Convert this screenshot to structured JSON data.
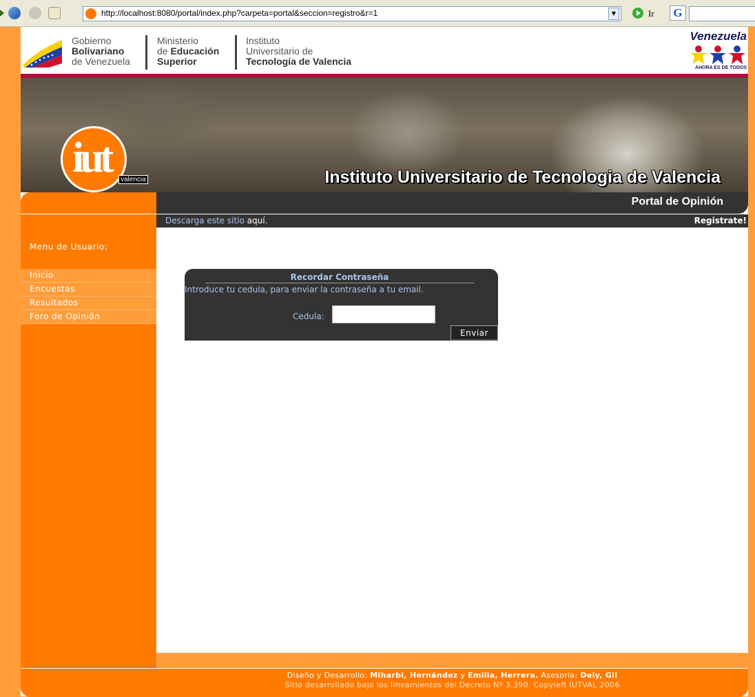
{
  "browser": {
    "url": "http://localhost:8080/portal/index.php?carpeta=portal&seccion=registro&r=1",
    "go_label": "Ir",
    "google_label": "G"
  },
  "gov_header": {
    "block1": {
      "line1": "Gobierno",
      "line2": "Bolivariano",
      "line3": "de Venezuela"
    },
    "block2": {
      "line1": "Ministerio",
      "line2_prefix": "de ",
      "line2_bold": "Educación",
      "line3": "Superior"
    },
    "block3": {
      "line1": "Instituto",
      "line2": "Universitario de",
      "line3": "Tecnología de Valencia"
    },
    "right_logo": {
      "word": "Venezuela",
      "tagline": "AHORA ES DE TODOS"
    }
  },
  "banner": {
    "logo_text": "iut",
    "logo_sub": "valencia",
    "title": "Instituto Universitario de Tecnologia de Valencia"
  },
  "portal": {
    "title": "Portal de Opinión"
  },
  "sub_strip": {
    "download_text": "Descarga este sitio",
    "download_link": "aquí.",
    "register_link": "Registrate!"
  },
  "sidebar": {
    "heading": "Menu de Usuario:",
    "items": [
      {
        "label": "Inicio"
      },
      {
        "label": "Encuestas"
      },
      {
        "label": "Resultados"
      },
      {
        "label": "Foro de Opinión"
      }
    ]
  },
  "form": {
    "title": "Recordar Contraseña",
    "instructions": "Introduce tu cedula, para enviar la contraseña a tu email.",
    "cedula_label": "Cedula:",
    "cedula_value": "",
    "submit_label": "Enviar"
  },
  "footer": {
    "line1_prefix": "Diseño y Desarrollo: ",
    "author1": "Miharbi, Hernández",
    "and": " y ",
    "author2": "Emilia, Herrera.",
    "advice_label": " Asesoría: ",
    "advisor": "Dely, Gil",
    "line2": "Sitio desarrollado bajo los lineamientos del Decreto Nº 3.390. Copyleft IUTVAL 2006"
  },
  "colors": {
    "orange": "#ff7a00",
    "light_orange": "#ff9d3a",
    "dark": "#333333",
    "link_blue": "#a9c5e8",
    "accent_red": "#b0103c"
  }
}
